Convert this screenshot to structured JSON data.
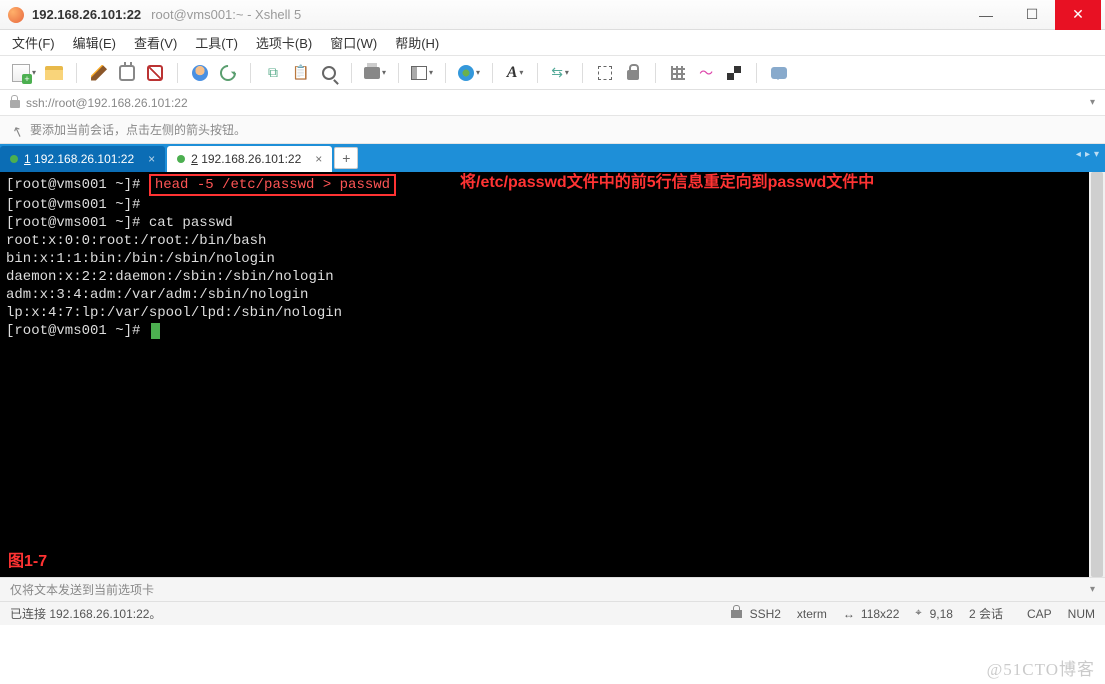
{
  "titlebar": {
    "title": "192.168.26.101:22",
    "subtitle": "root@vms001:~ - Xshell 5"
  },
  "menubar": {
    "file": "文件(F)",
    "edit": "编辑(E)",
    "view": "查看(V)",
    "tools": "工具(T)",
    "tabs": "选项卡(B)",
    "window": "窗口(W)",
    "help": "帮助(H)"
  },
  "addressbar": {
    "url": "ssh://root@192.168.26.101:22"
  },
  "infobar": {
    "text": "要添加当前会话，点击左侧的箭头按钮。"
  },
  "tabs": [
    {
      "index": "1",
      "label": "192.168.26.101:22",
      "active": true
    },
    {
      "index": "2",
      "label": "192.168.26.101:22",
      "active": false
    }
  ],
  "terminal": {
    "prompt": "[root@vms001 ~]#",
    "highlighted_cmd": "head -5 /etc/passwd > passwd",
    "annotation": "将/etc/passwd文件中的前5行信息重定向到passwd文件中",
    "lines": [
      "[root@vms001 ~]#",
      "[root@vms001 ~]# cat passwd",
      "root:x:0:0:root:/root:/bin/bash",
      "bin:x:1:1:bin:/bin:/sbin/nologin",
      "daemon:x:2:2:daemon:/sbin:/sbin/nologin",
      "adm:x:3:4:adm:/var/adm:/sbin/nologin",
      "lp:x:4:7:lp:/var/spool/lpd:/sbin/nologin",
      "[root@vms001 ~]# "
    ],
    "figure_label": "图1-7"
  },
  "msgbar": {
    "text": "仅将文本发送到当前选项卡"
  },
  "statusbar": {
    "connection": "已连接 192.168.26.101:22。",
    "protocol": "SSH2",
    "termtype": "xterm",
    "size": "118x22",
    "cursor": "9,18",
    "sessions": "2 会话",
    "caps": "CAP",
    "num": "NUM"
  },
  "watermark": "@51CTO博客"
}
